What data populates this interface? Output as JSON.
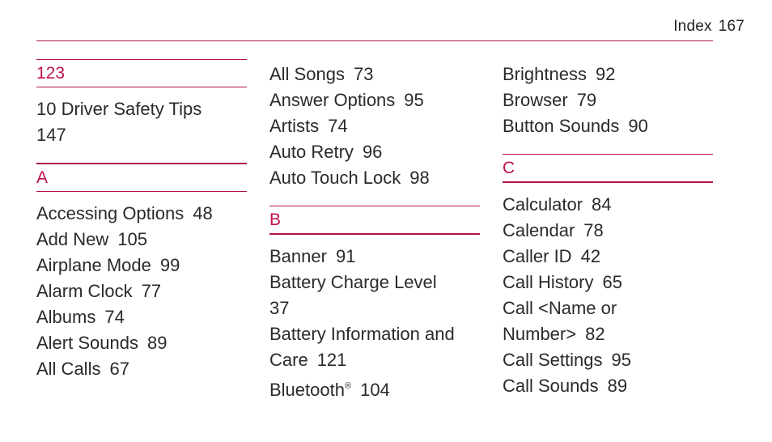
{
  "header": {
    "label": "Index",
    "page": "167"
  },
  "colors": {
    "accent": "#c0104f",
    "rule": "#b0134e",
    "text": "#2a2a2a"
  },
  "columns": [
    {
      "blocks": [
        {
          "heading": "123",
          "entries": [
            {
              "lines": [
                "10 Driver Safety Tips"
              ],
              "page_line": "147"
            }
          ]
        },
        {
          "heading": "A",
          "entries": [
            {
              "text": "Accessing Options",
              "page": "48"
            },
            {
              "text": "Add New",
              "page": "105"
            },
            {
              "text": "Airplane Mode",
              "page": "99"
            },
            {
              "text": "Alarm Clock",
              "page": "77"
            },
            {
              "text": "Albums",
              "page": "74"
            },
            {
              "text": "Alert Sounds",
              "page": "89"
            },
            {
              "text": "All Calls",
              "page": "67"
            }
          ]
        }
      ]
    },
    {
      "blocks": [
        {
          "heading": null,
          "entries": [
            {
              "text": "All Songs",
              "page": "73"
            },
            {
              "text": "Answer Options",
              "page": "95"
            },
            {
              "text": "Artists",
              "page": "74"
            },
            {
              "text": "Auto Retry",
              "page": "96"
            },
            {
              "text": "Auto Touch Lock",
              "page": "98"
            }
          ]
        },
        {
          "heading": "B",
          "entries": [
            {
              "text": "Banner",
              "page": "91"
            },
            {
              "text": "Battery Charge Level",
              "page": "37"
            },
            {
              "text": "Battery Information and Care",
              "page": "121"
            },
            {
              "text": "Bluetooth",
              "sup": "®",
              "page": "104"
            }
          ]
        }
      ]
    },
    {
      "blocks": [
        {
          "heading": null,
          "entries": [
            {
              "text": "Brightness",
              "page": "92"
            },
            {
              "text": "Browser",
              "page": "79"
            },
            {
              "text": "Button Sounds",
              "page": "90"
            }
          ]
        },
        {
          "heading": "C",
          "entries": [
            {
              "text": "Calculator",
              "page": "84"
            },
            {
              "text": "Calendar",
              "page": "78"
            },
            {
              "text": "Caller ID",
              "page": "42"
            },
            {
              "text": "Call History",
              "page": "65"
            },
            {
              "text": "Call <Name or Number>",
              "page": "82"
            },
            {
              "text": "Call Settings",
              "page": "95"
            },
            {
              "text": "Call Sounds",
              "page": "89"
            }
          ]
        }
      ]
    }
  ],
  "text": {
    "c1_h1": "123",
    "c1_e1_l1": "10 Driver Safety Tips",
    "c1_e1_l2": "147",
    "c1_h2": "A",
    "c1_e2": "Accessing Options",
    "c1_e2p": "48",
    "c1_e3": "Add New",
    "c1_e3p": "105",
    "c1_e4": "Airplane Mode",
    "c1_e4p": "99",
    "c1_e5": "Alarm Clock",
    "c1_e5p": "77",
    "c1_e6": "Albums",
    "c1_e6p": "74",
    "c1_e7": "Alert Sounds",
    "c1_e7p": "89",
    "c1_e8": "All Calls",
    "c1_e8p": "67",
    "c2_e1": "All Songs",
    "c2_e1p": "73",
    "c2_e2": "Answer Options",
    "c2_e2p": "95",
    "c2_e3": "Artists",
    "c2_e3p": "74",
    "c2_e4": "Auto Retry",
    "c2_e4p": "96",
    "c2_e5": "Auto Touch Lock",
    "c2_e5p": "98",
    "c2_h": "B",
    "c2_e6": "Banner",
    "c2_e6p": "91",
    "c2_e7_l1": "Battery Charge Level",
    "c2_e7_l2": "37",
    "c2_e8_l1": "Battery Information and",
    "c2_e8_l2": "Care",
    "c2_e8p": "121",
    "c2_e9": "Bluetooth",
    "c2_e9sup": "®",
    "c2_e9p": "104",
    "c3_e1": "Brightness",
    "c3_e1p": "92",
    "c3_e2": "Browser",
    "c3_e2p": "79",
    "c3_e3": "Button Sounds",
    "c3_e3p": "90",
    "c3_h": "C",
    "c3_e4": "Calculator",
    "c3_e4p": "84",
    "c3_e5": "Calendar",
    "c3_e5p": "78",
    "c3_e6": "Caller ID",
    "c3_e6p": "42",
    "c3_e7": "Call History",
    "c3_e7p": "65",
    "c3_e8_l1": "Call <Name or",
    "c3_e8_l2": "Number>",
    "c3_e8p": "82",
    "c3_e9": "Call Settings",
    "c3_e9p": "95",
    "c3_e10": "Call Sounds",
    "c3_e10p": "89"
  }
}
